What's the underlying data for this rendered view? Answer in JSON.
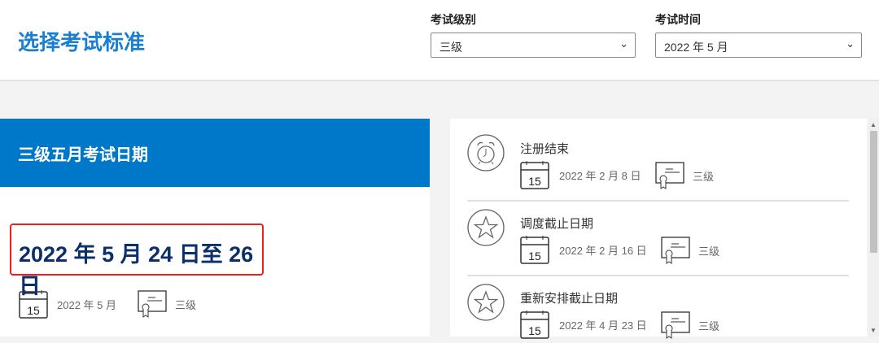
{
  "header": {
    "title": "选择考试标准",
    "level": {
      "label": "考试级别",
      "value": "三级"
    },
    "time": {
      "label": "考试时间",
      "value": "2022 年 5 月"
    }
  },
  "banner": {
    "title": "三级五月考试日期"
  },
  "main": {
    "date_range": "2022 年 5 月 24 日至 26 日",
    "month": "2022 年 5 月",
    "level": "三级"
  },
  "events": [
    {
      "title": "注册结束",
      "date": "2022 年 2 月 8 日",
      "level": "三级",
      "icon": "alarm-clock-icon"
    },
    {
      "title": "调度截止日期",
      "date": "2022 年 2 月 16 日",
      "level": "三级",
      "icon": "star-icon"
    },
    {
      "title": "重新安排截止日期",
      "date": "2022 年 4 月 23 日",
      "level": "三级",
      "icon": "star-icon"
    }
  ],
  "icons": {
    "calendar_day": "15"
  },
  "colors": {
    "brand": "#0078c9",
    "highlight": "#e8221f",
    "date_text": "#0b2f6a"
  }
}
